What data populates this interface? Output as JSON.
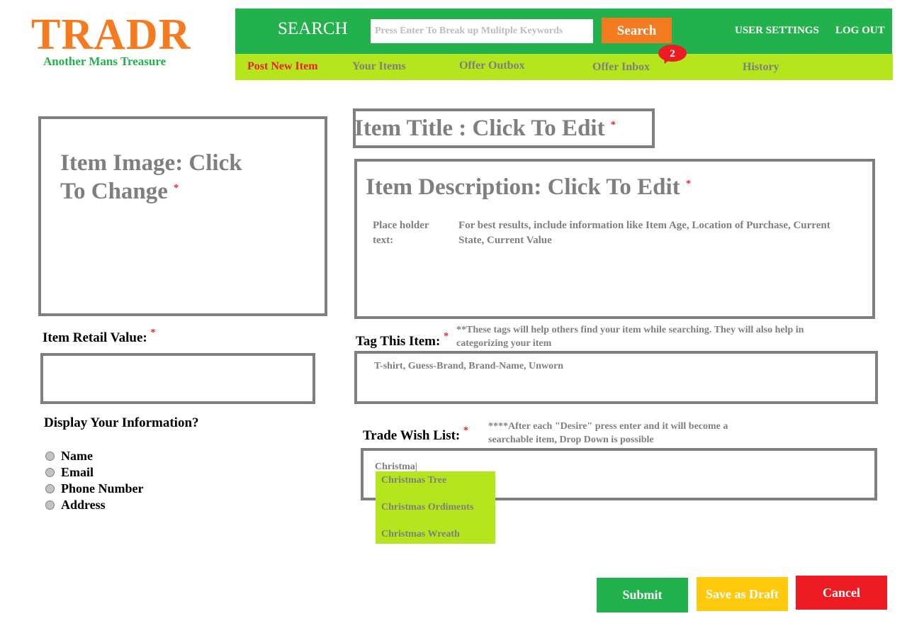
{
  "header": {
    "logo": "TRADR",
    "tagline": "Another Mans Treasure",
    "search_label": "SEARCH",
    "search_placeholder": "Press Enter To Break up Mulitple Keywords",
    "search_button": "Search",
    "user_settings": "USER SETTINGS",
    "log_out": "LOG OUT"
  },
  "nav": {
    "items": [
      {
        "label": "Post New Item",
        "active": true
      },
      {
        "label": "Your Items"
      },
      {
        "label": "Offer Outbox"
      },
      {
        "label": "Offer Inbox"
      },
      {
        "label": "History"
      }
    ],
    "inbox_badge": "2"
  },
  "form": {
    "image_text_line1": "Item Image: Click",
    "image_text_line2": "To Change",
    "title_text": "Item Title : Click To Edit",
    "description_heading": "Item Description: Click To Edit",
    "description_placeholder_label": "Place holder text:",
    "description_placeholder_text": "For best results, include information like Item Age, Location of Purchase, Current State, Current Value",
    "retail_value_label": "Item Retail Value:",
    "tag_label": "Tag This Item:",
    "tag_hint": "**These tags will help others find your item while searching. They will also help in categorizing your item",
    "tag_value": "T-shirt, Guess-Brand, Brand-Name, Unworn",
    "display_info_label": "Display Your Information?",
    "display_options": [
      "Name",
      "Email",
      "Phone Number",
      "Address"
    ],
    "wish_list_label": "Trade Wish List:",
    "wish_list_hint": "****After each \"Desire\" press enter and it will become a searchable item, Drop Down is possible",
    "wish_list_value": "Christma|",
    "suggestions": [
      "Christmas Tree",
      "Christmas Ordiments",
      "Christmas Wreath"
    ],
    "required_mark": "*"
  },
  "actions": {
    "submit": "Submit",
    "save_draft": "Save as Draft",
    "cancel": "Cancel"
  },
  "colors": {
    "green": "#22b14c",
    "lime": "#b5e61d",
    "orange": "#f47b20",
    "red": "#ed1c24",
    "yellow": "#ffc90e",
    "grey": "#7f7f7f"
  }
}
